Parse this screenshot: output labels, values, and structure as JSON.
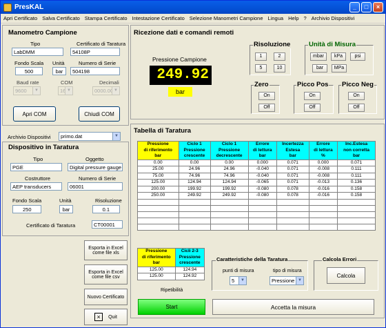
{
  "window": {
    "title": "PresKAL"
  },
  "menu": [
    "Apri Certificato",
    "Salva Certificato",
    "Stampa Certificato",
    "Intestazione Certificato",
    "Selezione Manometri Campione",
    "Lingua",
    "Help",
    "?",
    "Archivio Dispositivi"
  ],
  "manometro": {
    "title": "Manometro Campione",
    "tipo_label": "Tipo",
    "tipo": "LabDMM",
    "cert_label": "Certificato di Taratura",
    "cert": "54108P",
    "fondo_label": "Fondo Scala",
    "fondo": "500",
    "unita_label": "Unità",
    "unita": "bar",
    "serie_label": "Numero di Serie",
    "serie": "504198",
    "baud_label": "Baud rate",
    "baud": "9600",
    "com_label": "COM",
    "com": "16",
    "dec_label": "Decimali",
    "dec": "0000.00",
    "apri_com": "Apri COM",
    "chiudi_com": "Chiudi COM"
  },
  "archivio": {
    "label": "Archivio Dispositivi",
    "value": "primo.dat"
  },
  "dispositivo": {
    "title": "Dispositivo in Taratura",
    "tipo_label": "Tipo",
    "tipo": "PGE",
    "oggetto_label": "Oggetto",
    "oggetto": "Digital pressure gauge",
    "costr_label": "Costruttore",
    "costr": "AEP transducers",
    "serie_label": "Numero di Serie",
    "serie": "06001",
    "fondo_label": "Fondo Scala",
    "fondo": "250",
    "unita_label": "Unità",
    "unita": "bar",
    "ris_label": "Risoluzione",
    "ris": "0.1",
    "cert_label": "Certificato di Taratura",
    "cert": "CT00001"
  },
  "ricezione": {
    "title": "Ricezione dati e comandi remoti",
    "pressione_label": "Pressione Campione",
    "pressione": "249.92",
    "unita": "bar",
    "risoluzione": {
      "title": "Risoluzione",
      "buttons": [
        "1",
        "2",
        "5",
        "10"
      ]
    },
    "unita_misura": {
      "title": "Unità di Misura",
      "buttons": [
        "mbar",
        "kPa",
        "psi",
        "bar",
        "MPa"
      ]
    },
    "zero": {
      "title": "Zero",
      "on": "On",
      "off": "Off"
    },
    "picco_pos": {
      "title": "Picco Pos",
      "on": "On",
      "off": "Off"
    },
    "picco_neg": {
      "title": "Picco Neg",
      "on": "On",
      "off": "Off"
    }
  },
  "tabella": {
    "title": "Tabella di Taratura",
    "headers": [
      [
        "Pressione",
        "di riferimento",
        "bar"
      ],
      [
        "Ciclo 1",
        "Pressione",
        "crescente"
      ],
      [
        "Ciclo 1",
        "Pressione",
        "decrescente"
      ],
      [
        "Errore",
        "di lettura",
        "bar"
      ],
      [
        "Incertezza",
        "Estesa",
        "bar"
      ],
      [
        "Errore",
        "di lettura",
        "%"
      ],
      [
        "Inc.Estesa",
        "non corretta",
        "bar"
      ]
    ],
    "rows": [
      [
        "0.00",
        "0.00",
        "0.00",
        "0.000",
        "0.071",
        "0.000",
        "0.071"
      ],
      [
        "25.00",
        "24.96",
        "24.96",
        "-0.040",
        "0.071",
        "-0.008",
        "0.111"
      ],
      [
        "75.00",
        "74.96",
        "74.96",
        "-0.040",
        "0.071",
        "-0.008",
        "0.111"
      ],
      [
        "125.00",
        "124.94",
        "124.94",
        "-0.065",
        "0.071",
        "-0.013",
        "0.136"
      ],
      [
        "200.00",
        "199.92",
        "199.92",
        "-0.080",
        "0.078",
        "-0.016",
        "0.158"
      ],
      [
        "250.00",
        "249.92",
        "249.92",
        "-0.080",
        "0.078",
        "-0.016",
        "0.158"
      ],
      [
        "",
        "",
        "",
        "",
        "",
        "",
        ""
      ],
      [
        "",
        "",
        "",
        "",
        "",
        "",
        ""
      ],
      [
        "",
        "",
        "",
        "",
        "",
        "",
        ""
      ],
      [
        "",
        "",
        "",
        "",
        "",
        "",
        ""
      ],
      [
        "",
        "",
        "",
        "",
        "",
        "",
        ""
      ]
    ]
  },
  "ripetibilita": {
    "headers": [
      [
        "Pressione",
        "di riferimento",
        "bar"
      ],
      [
        "Cicli 2-3",
        "Pressione",
        "crescente"
      ]
    ],
    "rows": [
      [
        "125.00",
        "124.94"
      ],
      [
        "125.00",
        "124.92"
      ]
    ],
    "label": "Ripetibilità"
  },
  "caratteristiche": {
    "title": "Caratteristiche della Taratura",
    "punti_label": "punti di misura",
    "punti": "5",
    "tipo_label": "tipo di misura",
    "tipo": "Pressione"
  },
  "calcola": {
    "title": "Calcola Errori",
    "button": "Calcola"
  },
  "actions": {
    "excel_xls": [
      "Esporta in Excel",
      "come file xls"
    ],
    "excel_csv": [
      "Esporta in Excel",
      "come file csv"
    ],
    "nuovo": "Nuovo Certificato",
    "quit": "Quit",
    "start": "Start",
    "accetta": "Accetta la misura"
  },
  "colors": {
    "accent_yellow": "#ffff00",
    "accent_cyan": "#00ffff",
    "lcd_bg": "#000000",
    "lcd_fg": "#ffff00",
    "start_green": "#00d000"
  }
}
